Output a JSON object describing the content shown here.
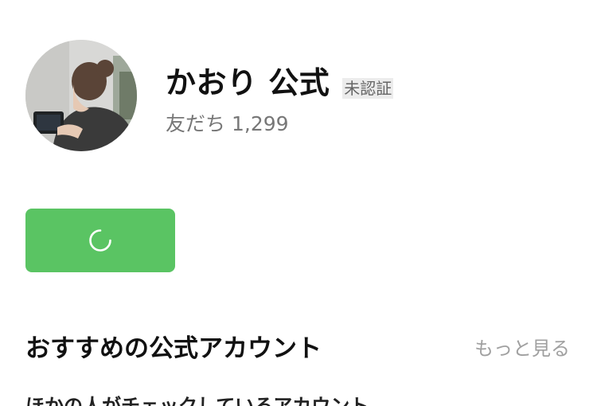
{
  "profile": {
    "name": "かおり 公式",
    "verification_badge": "未認証",
    "friends_label": "友だち",
    "friends_count": "1,299"
  },
  "primary_action": {
    "state": "loading",
    "spinner_icon": "loading-spinner-icon",
    "color": "#5ac463"
  },
  "recommendations": {
    "title": "おすすめの公式アカウント",
    "more_label": "もっと見る",
    "subsection_title": "ほかの人がチェックしているアカウント"
  }
}
